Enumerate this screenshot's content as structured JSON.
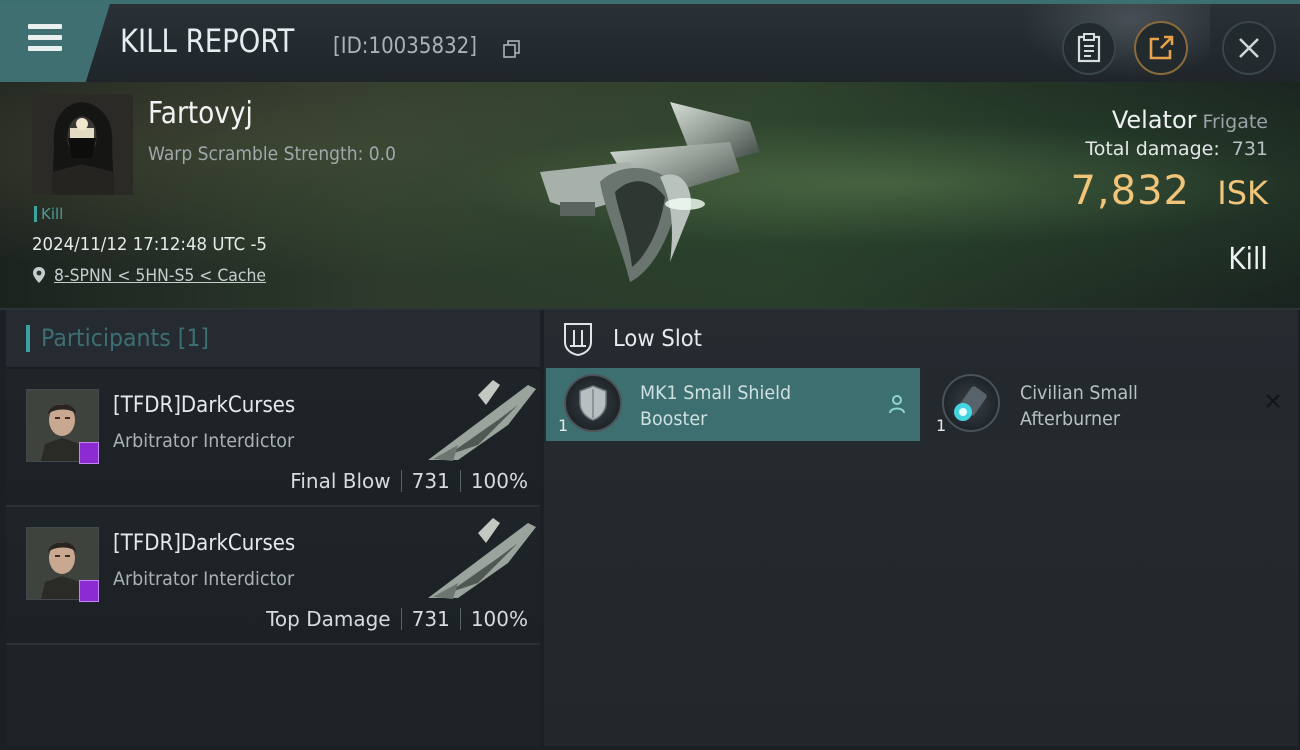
{
  "header": {
    "title": "KILL REPORT",
    "report_id": "[ID:10035832]"
  },
  "victim": {
    "name": "Fartovyj",
    "warp_scramble": "Warp Scramble Strength: 0.0",
    "tag": "Kill",
    "datetime": "2024/11/12 17:12:48 UTC -5",
    "location": "8-SPNN < 5HN-S5 < Cache",
    "ship_name": "Velator",
    "ship_class": "Frigate",
    "total_damage_label": "Total damage:",
    "total_damage": "731",
    "isk_value": "7,832",
    "isk_unit": "ISK",
    "result": "Kill"
  },
  "participants": {
    "header": "Participants [1]",
    "rows": [
      {
        "name": "[TFDR]DarkCurses",
        "ship": "Arbitrator Interdictor",
        "role": "Final Blow",
        "damage": "731",
        "percent": "100%"
      },
      {
        "name": "[TFDR]DarkCurses",
        "ship": "Arbitrator Interdictor",
        "role": "Top Damage",
        "damage": "731",
        "percent": "100%"
      }
    ]
  },
  "low_slot": {
    "title": "Low Slot",
    "modules": [
      {
        "qty": "1",
        "name_line1": "MK1 Small Shield",
        "name_line2": "Booster",
        "icon": "shield-booster-icon"
      },
      {
        "qty": "1",
        "name_line1": "Civilian Small",
        "name_line2": "Afterburner",
        "icon": "afterburner-icon"
      }
    ]
  },
  "colors": {
    "accent": "#3d6e70",
    "isk": "#f0c479",
    "kill_tag": "#3aa59c",
    "badge": "#8b2bd1"
  }
}
